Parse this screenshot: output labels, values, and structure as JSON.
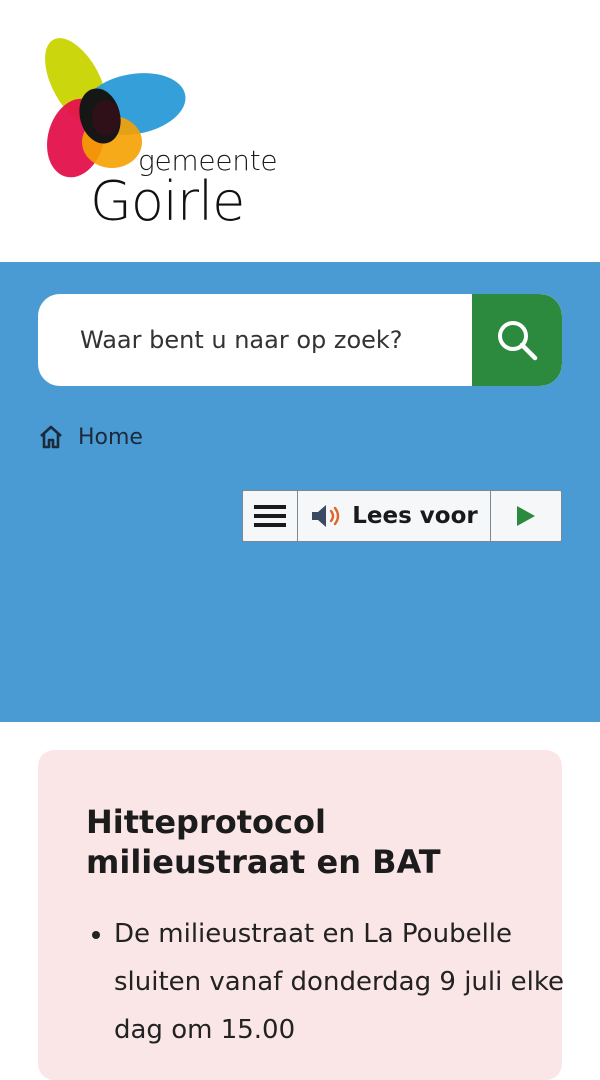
{
  "logo": {
    "small_text": "gemeente",
    "big_text": "Goirle"
  },
  "search": {
    "placeholder": "Waar bent u naar op zoek?"
  },
  "breadcrumb": {
    "home_label": "Home"
  },
  "reader": {
    "read_label": "Lees voor"
  },
  "notice": {
    "title": "Hitteprotocol milieustraat en BAT",
    "items": [
      "De milieustraat en La Poubelle sluiten vanaf donderdag 9 juli elke dag om 15.00"
    ]
  },
  "colors": {
    "banner": "#4a9bd3",
    "search_button": "#2b8a3e",
    "notice_bg": "#fbe6e7"
  }
}
